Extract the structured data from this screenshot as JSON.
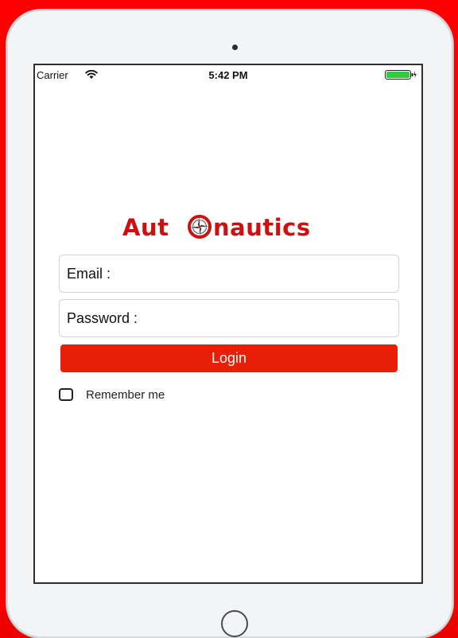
{
  "status_bar": {
    "carrier": "Carrier",
    "time": "5:42 PM",
    "wifi_icon": "wifi-icon",
    "battery_icon": "battery-icon",
    "battery_color": "#2ecc40"
  },
  "logo": {
    "text_before": "Aut",
    "text_after": "nautics",
    "compass_icon": "compass-icon",
    "color": "#cc1111"
  },
  "form": {
    "email_label": "Email :",
    "email_value": "",
    "password_label": "Password :",
    "password_value": "",
    "login_label": "Login",
    "login_color": "#e81e06",
    "remember_label": "Remember me",
    "remember_checked": false
  },
  "frame": {
    "background_color": "#ff0000"
  }
}
